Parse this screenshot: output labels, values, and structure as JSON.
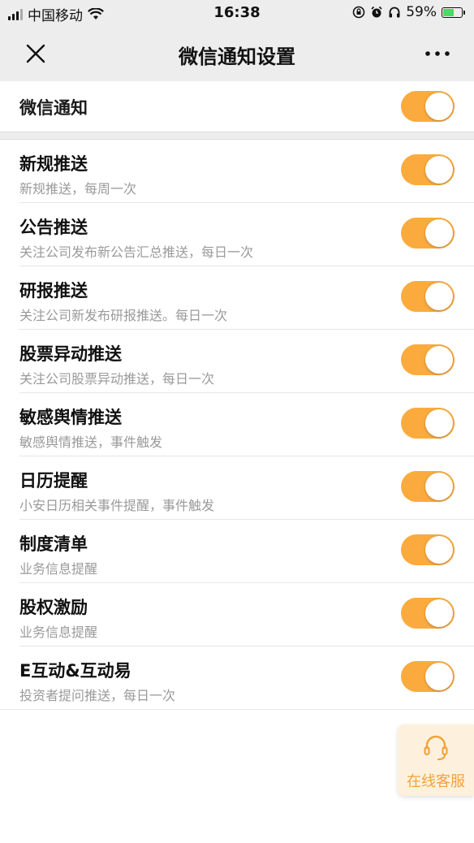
{
  "status_bar": {
    "carrier": "中国移动",
    "time": "16:38",
    "battery_percent": "59%"
  },
  "nav": {
    "title": "微信通知设置",
    "close_icon": "close-icon",
    "more_icon": "more-icon"
  },
  "master": {
    "label": "微信通知",
    "enabled": true
  },
  "items": [
    {
      "title": "新规推送",
      "subtitle": "新规推送，每周一次",
      "enabled": true
    },
    {
      "title": "公告推送",
      "subtitle": "关注公司发布新公告汇总推送，每日一次",
      "enabled": true
    },
    {
      "title": "研报推送",
      "subtitle": "关注公司新发布研报推送。每日一次",
      "enabled": true
    },
    {
      "title": "股票异动推送",
      "subtitle": "关注公司股票异动推送，每日一次",
      "enabled": true
    },
    {
      "title": "敏感舆情推送",
      "subtitle": "敏感舆情推送，事件触发",
      "enabled": true
    },
    {
      "title": "日历提醒",
      "subtitle": "小安日历相关事件提醒，事件触发",
      "enabled": true
    },
    {
      "title": "制度清单",
      "subtitle": "业务信息提醒",
      "enabled": true
    },
    {
      "title": "股权激励",
      "subtitle": "业务信息提醒",
      "enabled": true
    },
    {
      "title": "E互动&互动易",
      "subtitle": "投资者提问推送，每日一次",
      "enabled": true
    }
  ],
  "service": {
    "label": "在线客服",
    "icon": "headset-icon"
  },
  "colors": {
    "accent": "#fbab3d",
    "background": "#ededed"
  }
}
